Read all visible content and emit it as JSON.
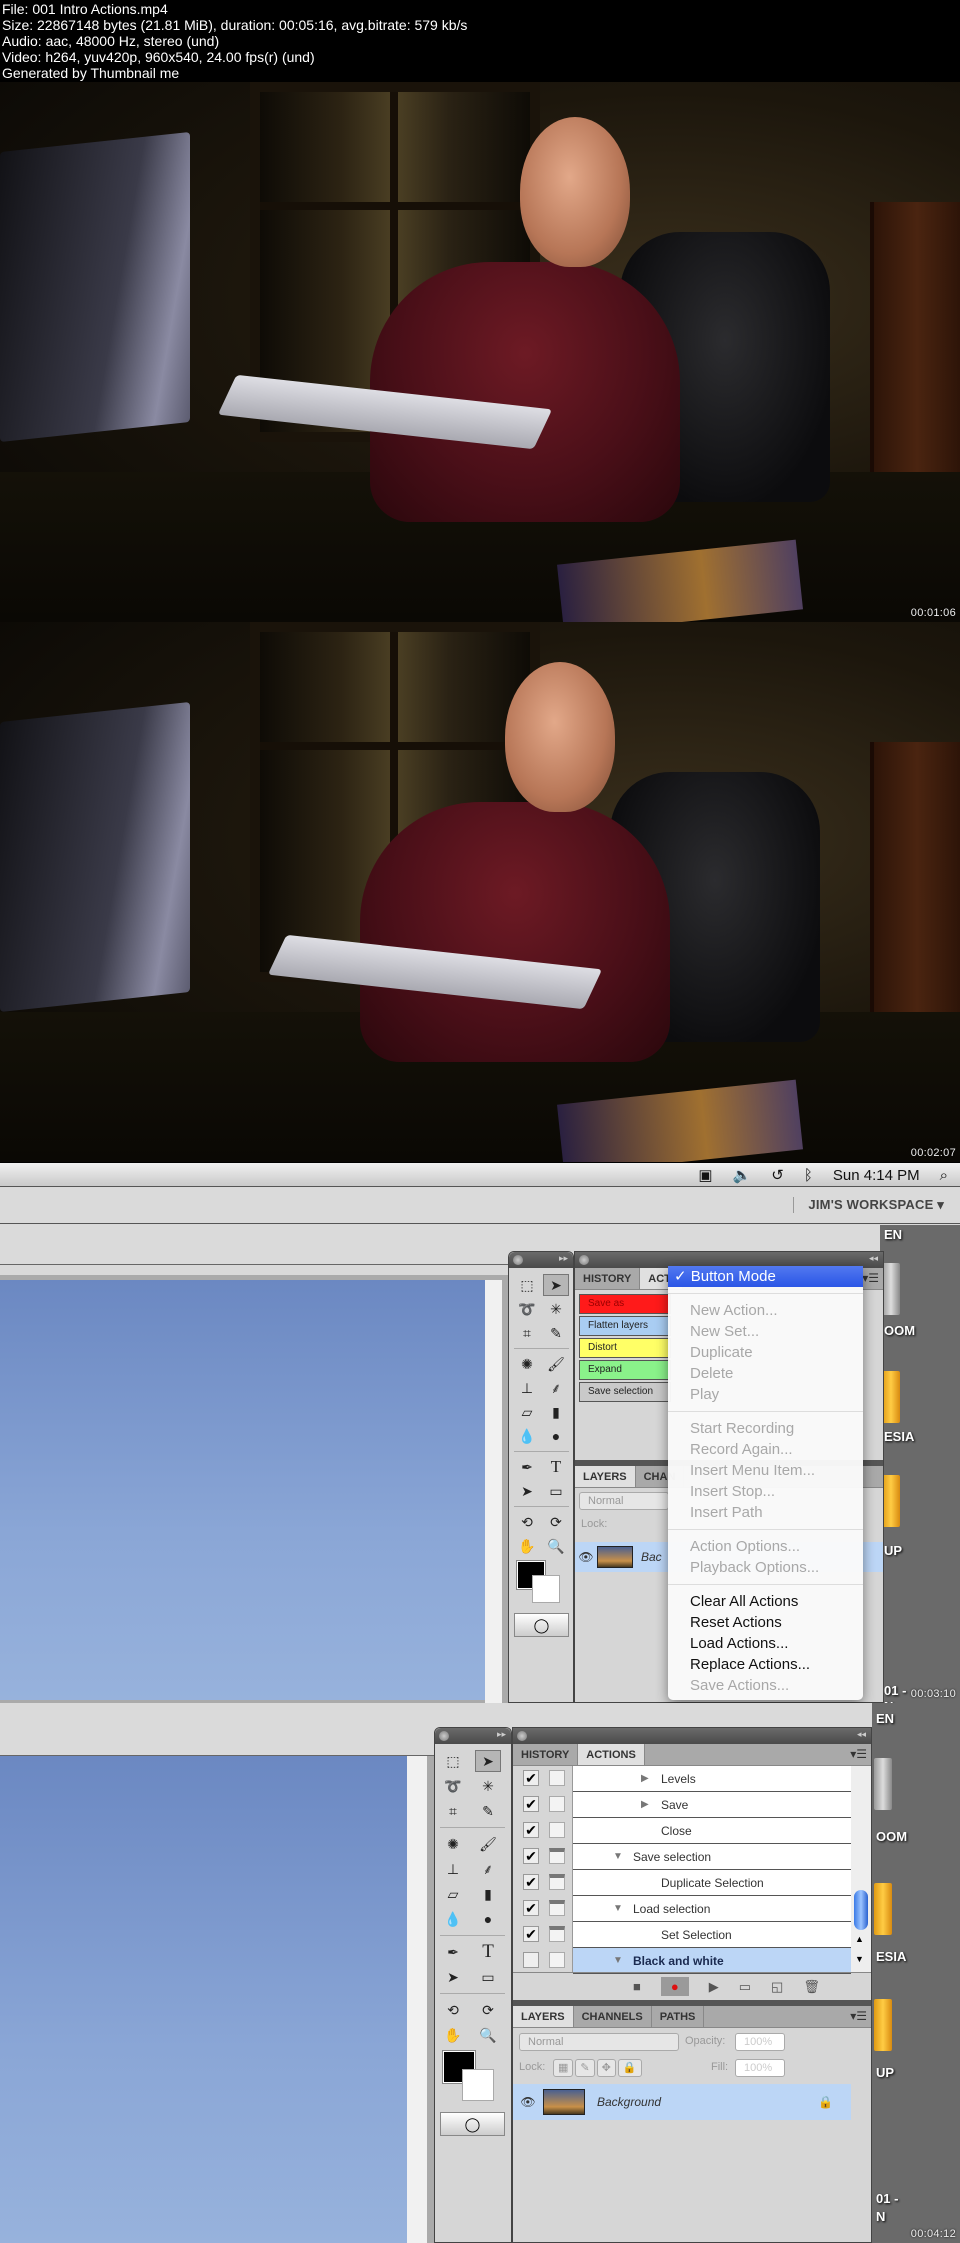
{
  "header": {
    "file": "File: 001 Intro  Actions.mp4",
    "size": "Size: 22867148 bytes (21.81 MiB), duration: 00:05:16, avg.bitrate: 579 kb/s",
    "audio": "Audio: aac, 48000 Hz, stereo (und)",
    "video": "Video: h264, yuv420p, 960x540, 24.00 fps(r) (und)",
    "generator": "Generated by Thumbnail me"
  },
  "frames": [
    {
      "timestamp": "00:01:06",
      "kind": "video"
    },
    {
      "timestamp": "00:02:07",
      "kind": "video"
    },
    {
      "timestamp": "00:03:10",
      "kind": "photoshop-button-mode"
    },
    {
      "timestamp": "00:04:12",
      "kind": "photoshop-list-mode"
    }
  ],
  "menubar": {
    "icons": [
      "camera-icon",
      "volume-icon",
      "time-machine-icon",
      "bluetooth-icon"
    ],
    "clock": "Sun 4:14 PM",
    "search_icon": "spotlight-icon"
  },
  "workspace": "JIM'S WORKSPACE ▾",
  "desktop_labels": [
    "EN",
    "OOM",
    "ESIA",
    "UP",
    "01 -",
    "N"
  ],
  "panel_tabs": {
    "history": "HISTORY",
    "actions_partial": "ACTI",
    "actions": "ACTIONS"
  },
  "button_mode_actions": [
    {
      "label": "Save as",
      "color": "#ff1a1a"
    },
    {
      "label": "Flatten layers",
      "color": "#a9cdf2"
    },
    {
      "label": "Distort",
      "color": "#ffff66"
    },
    {
      "label": "Expand",
      "color": "#8af28a"
    },
    {
      "label": "Save selection",
      "color": "#c9c9c9"
    }
  ],
  "actions_menu": {
    "checked": "Button Mode",
    "groups": [
      [
        "New Action...",
        "New Set...",
        "Duplicate",
        "Delete",
        "Play"
      ],
      [
        "Start Recording",
        "Record Again...",
        "Insert Menu Item...",
        "Insert Stop...",
        "Insert Path"
      ],
      [
        "Action Options...",
        "Playback Options..."
      ]
    ],
    "enabled": [
      "Clear All Actions",
      "Reset Actions",
      "Load Actions...",
      "Replace Actions..."
    ],
    "disabled_last": "Save Actions..."
  },
  "layers_panel": {
    "tabs": [
      "LAYERS",
      "CHANNELS",
      "PATHS"
    ],
    "tab_partial": "CHAN",
    "blend_mode": "Normal",
    "opacity_label": "Opacity:",
    "opacity_value": "100%",
    "lock_label": "Lock:",
    "fill_label": "Fill:",
    "fill_value": "100%",
    "layer_name": "Background",
    "layer_partial": "Bac"
  },
  "actions_list": [
    {
      "name": "Levels",
      "indent": 2,
      "expander": "right",
      "checked": true,
      "dialog": false
    },
    {
      "name": "Save",
      "indent": 2,
      "expander": "right",
      "checked": true,
      "dialog": false
    },
    {
      "name": "Close",
      "indent": 2,
      "expander": "none",
      "checked": true,
      "dialog": false
    },
    {
      "name": "Save selection",
      "indent": 1,
      "expander": "down",
      "checked": true,
      "dialog": true
    },
    {
      "name": "Duplicate Selection",
      "indent": 2,
      "expander": "none",
      "checked": true,
      "dialog": true
    },
    {
      "name": "Load selection",
      "indent": 1,
      "expander": "down",
      "checked": true,
      "dialog": true
    },
    {
      "name": "Set Selection",
      "indent": 2,
      "expander": "none",
      "checked": true,
      "dialog": true
    },
    {
      "name": "Black and white",
      "indent": 1,
      "expander": "down",
      "checked": false,
      "dialog": false,
      "selected": true
    }
  ],
  "actions_toolbar": [
    "stop-icon",
    "record-icon",
    "play-icon",
    "new-set-icon",
    "new-action-icon",
    "delete-icon"
  ]
}
